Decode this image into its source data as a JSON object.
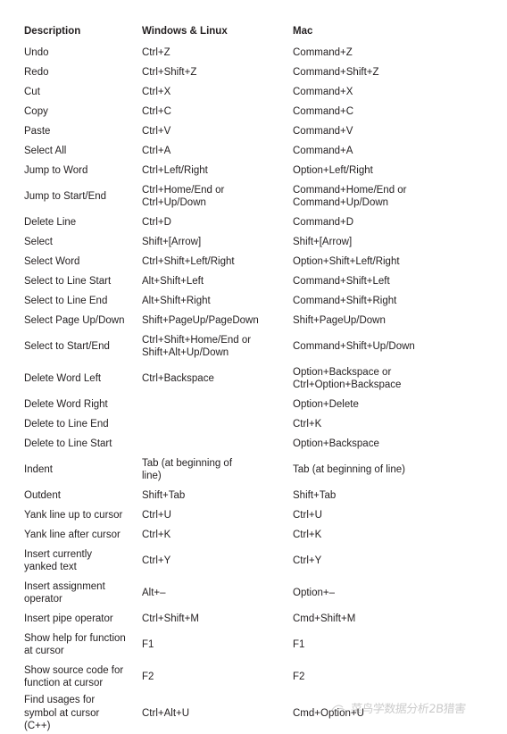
{
  "table": {
    "columns": [
      "Description",
      "Windows & Linux",
      "Mac"
    ],
    "rows": [
      {
        "desc": [
          "Undo"
        ],
        "win": [
          "Ctrl+Z"
        ],
        "mac": [
          "Command+Z"
        ]
      },
      {
        "desc": [
          "Redo"
        ],
        "win": [
          "Ctrl+Shift+Z"
        ],
        "mac": [
          "Command+Shift+Z"
        ]
      },
      {
        "desc": [
          "Cut"
        ],
        "win": [
          "Ctrl+X"
        ],
        "mac": [
          "Command+X"
        ]
      },
      {
        "desc": [
          "Copy"
        ],
        "win": [
          "Ctrl+C"
        ],
        "mac": [
          "Command+C"
        ]
      },
      {
        "desc": [
          "Paste"
        ],
        "win": [
          "Ctrl+V"
        ],
        "mac": [
          "Command+V"
        ]
      },
      {
        "desc": [
          "Select All"
        ],
        "win": [
          "Ctrl+A"
        ],
        "mac": [
          "Command+A"
        ]
      },
      {
        "desc": [
          "Jump to Word"
        ],
        "win": [
          "Ctrl+Left/Right"
        ],
        "mac": [
          "Option+Left/Right"
        ]
      },
      {
        "desc": [
          "Jump to Start/End"
        ],
        "win": [
          "Ctrl+Home/End or",
          "Ctrl+Up/Down"
        ],
        "mac": [
          "Command+Home/End or",
          "Command+Up/Down"
        ]
      },
      {
        "desc": [
          "Delete Line"
        ],
        "win": [
          "Ctrl+D"
        ],
        "mac": [
          "Command+D"
        ]
      },
      {
        "desc": [
          "Select"
        ],
        "win": [
          "Shift+[Arrow]"
        ],
        "mac": [
          "Shift+[Arrow]"
        ]
      },
      {
        "desc": [
          "Select Word"
        ],
        "win": [
          "Ctrl+Shift+Left/Right"
        ],
        "mac": [
          "Option+Shift+Left/Right"
        ]
      },
      {
        "desc": [
          "Select to Line Start"
        ],
        "win": [
          "Alt+Shift+Left"
        ],
        "mac": [
          "Command+Shift+Left"
        ]
      },
      {
        "desc": [
          "Select to Line End"
        ],
        "win": [
          "Alt+Shift+Right"
        ],
        "mac": [
          "Command+Shift+Right"
        ]
      },
      {
        "desc": [
          "Select Page Up/Down"
        ],
        "win": [
          "Shift+PageUp/PageDown"
        ],
        "mac": [
          "Shift+PageUp/Down"
        ]
      },
      {
        "desc": [
          "Select to Start/End"
        ],
        "win": [
          "Ctrl+Shift+Home/End or",
          "Shift+Alt+Up/Down"
        ],
        "mac": [
          "Command+Shift+Up/Down"
        ]
      },
      {
        "desc": [
          "Delete Word Left"
        ],
        "win": [
          "Ctrl+Backspace"
        ],
        "mac": [
          "Option+Backspace or",
          "Ctrl+Option+Backspace"
        ]
      },
      {
        "desc": [
          "Delete Word Right"
        ],
        "win": [],
        "mac": [
          "Option+Delete"
        ]
      },
      {
        "desc": [
          "Delete to Line End"
        ],
        "win": [],
        "mac": [
          "Ctrl+K"
        ]
      },
      {
        "desc": [
          "Delete to Line Start"
        ],
        "win": [],
        "mac": [
          "Option+Backspace"
        ]
      },
      {
        "desc": [
          "Indent"
        ],
        "win": [
          "Tab (at beginning of",
          "line)"
        ],
        "mac": [
          "Tab (at beginning of line)"
        ]
      },
      {
        "desc": [
          "Outdent"
        ],
        "win": [
          "Shift+Tab"
        ],
        "mac": [
          "Shift+Tab"
        ]
      },
      {
        "desc": [
          "Yank line up to cursor"
        ],
        "win": [
          "Ctrl+U"
        ],
        "mac": [
          "Ctrl+U"
        ]
      },
      {
        "desc": [
          "Yank line after cursor"
        ],
        "win": [
          "Ctrl+K"
        ],
        "mac": [
          "Ctrl+K"
        ]
      },
      {
        "desc": [
          "Insert currently",
          "yanked text"
        ],
        "win": [
          "Ctrl+Y"
        ],
        "mac": [
          "Ctrl+Y"
        ]
      },
      {
        "desc": [
          "Insert assignment",
          "operator"
        ],
        "win": [
          "Alt+–"
        ],
        "mac": [
          "Option+–"
        ]
      },
      {
        "desc": [
          "Insert pipe operator"
        ],
        "win": [
          "Ctrl+Shift+M"
        ],
        "mac": [
          "Cmd+Shift+M"
        ]
      },
      {
        "desc": [
          "Show help for function",
          "at cursor"
        ],
        "win": [
          "F1"
        ],
        "mac": [
          "F1"
        ]
      },
      {
        "desc": [
          "Show source code for",
          "function at cursor"
        ],
        "win": [
          "F2"
        ],
        "mac": [
          "F2"
        ]
      },
      {
        "desc": [
          "Find usages for",
          "symbol at cursor",
          "(C++)"
        ],
        "win": [
          "Ctrl+Alt+U"
        ],
        "mac": [
          "Cmd+Option+U"
        ]
      }
    ]
  },
  "watermark": {
    "text": "菜鸟学数据分析2B猎害"
  }
}
